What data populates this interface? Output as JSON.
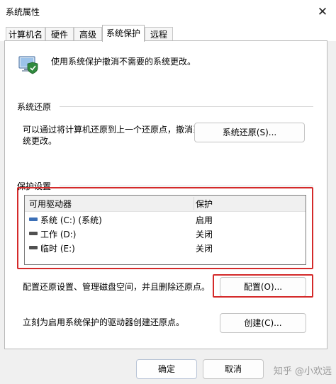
{
  "window": {
    "title": "系统属性"
  },
  "tabs": [
    {
      "label": "计算机名"
    },
    {
      "label": "硬件"
    },
    {
      "label": "高级"
    },
    {
      "label": "系统保护"
    },
    {
      "label": "远程"
    }
  ],
  "intro": {
    "text": "使用系统保护撤消不需要的系统更改。"
  },
  "restore": {
    "section_title": "系统还原",
    "description_line1": "可以通过将计算机还原到上一个还原点，撤消系",
    "description_line2": "统更改。",
    "button_label": "系统还原(S)..."
  },
  "protection": {
    "section_title": "保护设置",
    "columns": {
      "drive": "可用驱动器",
      "protection": "保护"
    },
    "drives": [
      {
        "name": "系统 (C:) (系统)",
        "status": "启用"
      },
      {
        "name": "工作 (D:)",
        "status": "关闭"
      },
      {
        "name": "临时 (E:)",
        "status": "关闭"
      }
    ],
    "configure_text": "配置还原设置、管理磁盘空间，并且删除还原点。",
    "configure_button": "配置(O)...",
    "create_text": "立刻为启用系统保护的驱动器创建还原点。",
    "create_button": "创建(C)..."
  },
  "footer": {
    "ok_label": "确定",
    "cancel_label": "取消"
  },
  "watermark": {
    "text": "知乎 @小欢远"
  },
  "colors": {
    "highlight": "#d42a2a",
    "selected_row": "#cce4f7"
  }
}
